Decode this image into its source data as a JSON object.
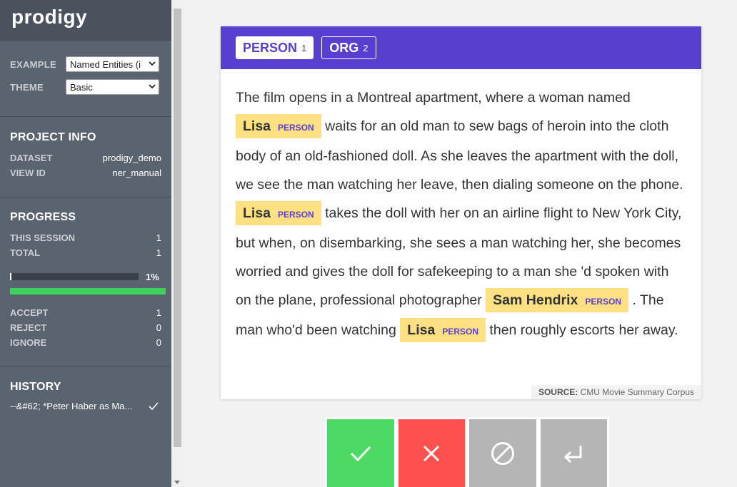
{
  "app": {
    "brand": "prodigy"
  },
  "settings": {
    "example_label": "EXAMPLE",
    "example_value": "Named Entities (i",
    "theme_label": "THEME",
    "theme_value": "Basic"
  },
  "project_info": {
    "title": "PROJECT INFO",
    "dataset_label": "DATASET",
    "dataset_value": "prodigy_demo",
    "view_id_label": "VIEW ID",
    "view_id_value": "ner_manual"
  },
  "progress": {
    "title": "PROGRESS",
    "this_session_label": "THIS SESSION",
    "this_session_value": "1",
    "total_label": "TOTAL",
    "total_value": "1",
    "percent": 1,
    "percent_text": "1%",
    "accept_label": "ACCEPT",
    "accept_value": "1",
    "reject_label": "REJECT",
    "reject_value": "0",
    "ignore_label": "IGNORE",
    "ignore_value": "0"
  },
  "history": {
    "title": "HISTORY",
    "items": [
      {
        "text": "--&#62; *Peter Haber as Ma...",
        "status": "accepted"
      }
    ]
  },
  "labels": [
    {
      "name": "PERSON",
      "key": "1",
      "active": true
    },
    {
      "name": "ORG",
      "key": "2",
      "active": false
    }
  ],
  "text": {
    "seg1": "The film opens in a Montreal apartment, where a woman named ",
    "ent1_text": "Lisa",
    "ent1_label": "PERSON",
    "seg2": " waits for an old man to sew bags of heroin into the cloth body of an old-fashioned doll. As she leaves the apartment with the doll, we see the man watching her leave, then dialing someone on the phone. ",
    "ent2_text": "Lisa",
    "ent2_label": "PERSON",
    "seg3": " takes the doll with her on an airline flight to New York City, but when, on disembarking, she sees a man watching her, she becomes worried and gives the doll for safekeeping to a man she 'd spoken with on the plane, professional photographer ",
    "ent3_text": "Sam Hendrix",
    "ent3_label": "PERSON",
    "seg4": " . The man who'd been watching ",
    "ent4_text": "Lisa",
    "ent4_label": "PERSON",
    "seg5": " then roughly escorts her away."
  },
  "source": {
    "label": "SOURCE:",
    "value": "CMU Movie Summary Corpus"
  },
  "actions": {
    "accept_icon": "check-icon",
    "reject_icon": "close-icon",
    "ignore_icon": "ignore-icon",
    "undo_icon": "undo-icon"
  },
  "colors": {
    "accent": "#583fcf",
    "entity_bg": "#ffe184",
    "accept": "#4cd964",
    "reject": "#ff5050",
    "ignore": "#b5b5b5"
  }
}
